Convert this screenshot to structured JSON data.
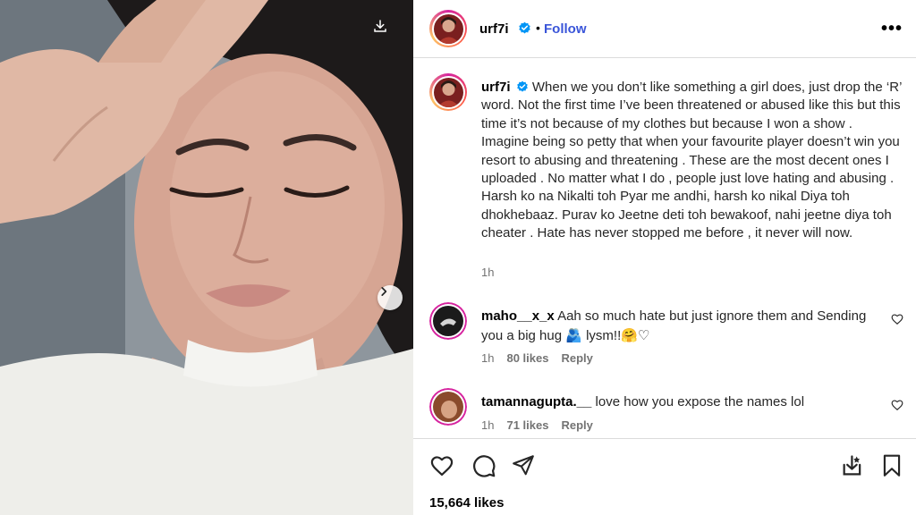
{
  "post": {
    "username": "urf7i",
    "follow_label": "Follow",
    "more_icon": "more-options-icon",
    "separator": "•"
  },
  "caption": {
    "username": "urf7i",
    "text": "When we you don’t like something a girl does, just drop the ‘R’ word. Not the first time I’ve been threatened or abused like this but this time it’s not because of my clothes but because I won a show . Imagine being so petty that when your favourite player doesn’t win you resort to abusing and threatening . These are the most decent ones I uploaded . No matter what I do , people just love hating and abusing . Harsh ko na Nikalti toh Pyar me andhi, harsh ko nikal Diya toh dhokhebaaz. Purav ko Jeetne deti toh bewakoof, nahi jeetne diya toh cheater . Hate has never stopped me before , it never will now.",
    "time": "1h"
  },
  "comments": [
    {
      "username": "maho__x_x",
      "text": "Aah so much hate but just ignore them and Sending you a big hug 🫂 lysm!!🤗♡",
      "time": "1h",
      "likes": "80 likes",
      "reply_label": "Reply"
    },
    {
      "username": "tamannagupta.__",
      "text": "love how you expose the names lol",
      "time": "1h",
      "likes": "71 likes",
      "reply_label": "Reply"
    }
  ],
  "footer": {
    "likes": "15,664 likes"
  },
  "colors": {
    "follow": "#3a55d9",
    "verified": "#0095f6",
    "meta": "#737373",
    "divider": "#dbdbdb"
  },
  "icons": [
    "download-icon",
    "chevron-right-icon",
    "verified-badge-icon",
    "heart-icon",
    "comment-icon",
    "share-icon",
    "save-collection-icon",
    "bookmark-icon"
  ]
}
